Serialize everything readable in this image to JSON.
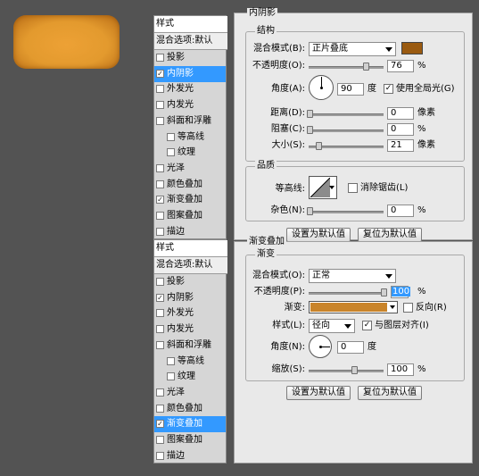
{
  "colors": {
    "inner_shadow_swatch": "#9a5a10",
    "gradient_preview": "#c9842a",
    "preview_button": "#e39a2e",
    "selected_row": "#3399ff"
  },
  "list_top": {
    "header": "样式",
    "blend_default": "混合选项:默认",
    "items": [
      {
        "label": "投影",
        "checked": false,
        "indent": false
      },
      {
        "label": "内阴影",
        "checked": true,
        "indent": false,
        "selected": true
      },
      {
        "label": "外发光",
        "checked": false,
        "indent": false
      },
      {
        "label": "内发光",
        "checked": false,
        "indent": false
      },
      {
        "label": "斜面和浮雕",
        "checked": false,
        "indent": false
      },
      {
        "label": "等高线",
        "checked": false,
        "indent": true
      },
      {
        "label": "纹理",
        "checked": false,
        "indent": true
      },
      {
        "label": "光泽",
        "checked": false,
        "indent": false
      },
      {
        "label": "颜色叠加",
        "checked": false,
        "indent": false
      },
      {
        "label": "渐变叠加",
        "checked": true,
        "indent": false
      },
      {
        "label": "图案叠加",
        "checked": false,
        "indent": false
      },
      {
        "label": "描边",
        "checked": false,
        "indent": false
      }
    ]
  },
  "list_bottom": {
    "header": "样式",
    "blend_default": "混合选项:默认",
    "items": [
      {
        "label": "投影",
        "checked": false,
        "indent": false
      },
      {
        "label": "内阴影",
        "checked": true,
        "indent": false
      },
      {
        "label": "外发光",
        "checked": false,
        "indent": false
      },
      {
        "label": "内发光",
        "checked": false,
        "indent": false
      },
      {
        "label": "斜面和浮雕",
        "checked": false,
        "indent": false
      },
      {
        "label": "等高线",
        "checked": false,
        "indent": true
      },
      {
        "label": "纹理",
        "checked": false,
        "indent": true
      },
      {
        "label": "光泽",
        "checked": false,
        "indent": false
      },
      {
        "label": "颜色叠加",
        "checked": false,
        "indent": false
      },
      {
        "label": "渐变叠加",
        "checked": true,
        "indent": false,
        "selected": true
      },
      {
        "label": "图案叠加",
        "checked": false,
        "indent": false
      },
      {
        "label": "描边",
        "checked": false,
        "indent": false
      }
    ]
  },
  "inner_shadow": {
    "title": "内阴影",
    "structure": "结构",
    "blend_label": "混合模式(B):",
    "blend_value": "正片叠底",
    "opacity_label": "不透明度(O):",
    "opacity_value": "76",
    "opacity": 76,
    "percent": "%",
    "angle_label": "角度(A):",
    "angle_value": "90",
    "angle": 90,
    "degree": "度",
    "global_light_label": "使用全局光(G)",
    "global_light_checked": true,
    "distance_label": "距离(D):",
    "distance_value": "0",
    "distance": 0,
    "pixel": "像素",
    "choke_label": "阻塞(C):",
    "choke_value": "0",
    "choke": 0,
    "size_label": "大小(S):",
    "size_value": "21",
    "size": 21,
    "quality": "品质",
    "contour_label": "等高线:",
    "antialias_label": "消除锯齿(L)",
    "antialias_checked": false,
    "noise_label": "杂色(N):",
    "noise_value": "0",
    "noise": 0,
    "set_default": "设置为默认值",
    "reset_default": "复位为默认值"
  },
  "gradient_overlay": {
    "title": "渐变叠加",
    "group": "渐变",
    "blend_label": "混合模式(O):",
    "blend_value": "正常",
    "opacity_label": "不透明度(P):",
    "opacity_value": "100",
    "opacity": 100,
    "percent": "%",
    "gradient_label": "渐变:",
    "reverse_label": "反向(R)",
    "reverse_checked": false,
    "style_label": "样式(L):",
    "style_value": "径向",
    "align_label": "与图层对齐(I)",
    "align_checked": true,
    "angle_label": "角度(N):",
    "angle_value": "0",
    "angle": 0,
    "degree": "度",
    "scale_label": "缩放(S):",
    "scale_value": "100",
    "scale": 100,
    "set_default": "设置为默认值",
    "reset_default": "复位为默认值"
  }
}
